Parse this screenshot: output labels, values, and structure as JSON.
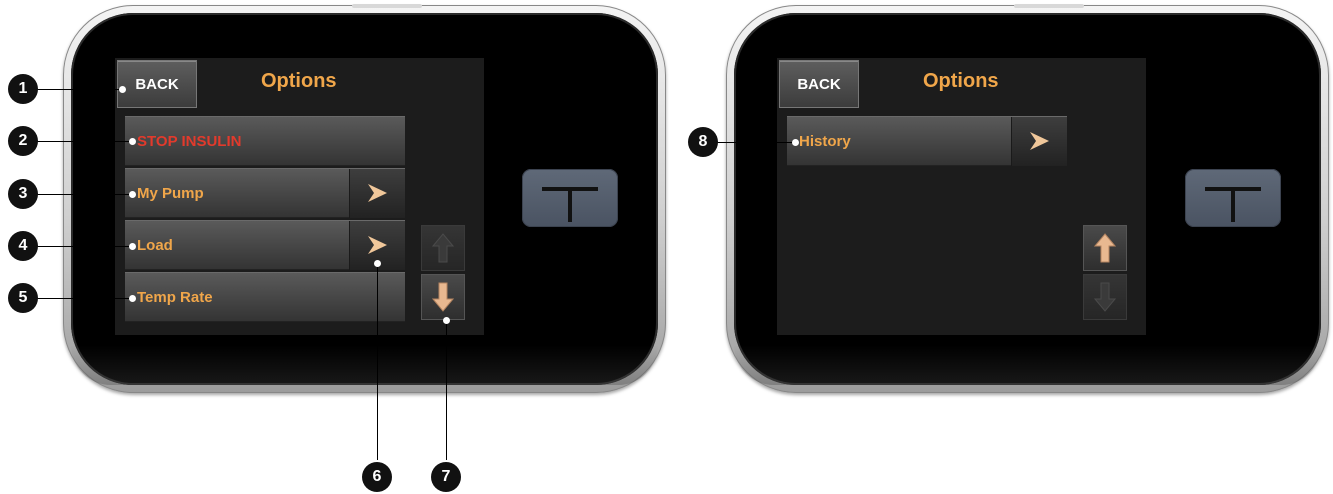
{
  "left_screen": {
    "back_label": "BACK",
    "title": "Options",
    "menu": [
      {
        "label": "STOP INSULIN",
        "has_arrow": false,
        "color": "#e23a2c"
      },
      {
        "label": "My Pump",
        "has_arrow": true
      },
      {
        "label": "Load",
        "has_arrow": true
      },
      {
        "label": "Temp Rate",
        "has_arrow": false
      }
    ],
    "scroll": {
      "up_enabled": false,
      "down_enabled": true
    }
  },
  "right_screen": {
    "back_label": "BACK",
    "title": "Options",
    "menu": [
      {
        "label": "History",
        "has_arrow": true
      }
    ],
    "scroll": {
      "up_enabled": true,
      "down_enabled": false
    }
  },
  "callouts": [
    "1",
    "2",
    "3",
    "4",
    "5",
    "6",
    "7",
    "8"
  ],
  "colors": {
    "accent": "#f0a64a",
    "stop": "#e23a2c",
    "screen": "#1c1c1c",
    "home_button": "#555f6e"
  },
  "icons": {
    "menu_arrow": "chevron-right-icon",
    "home": "t-logo-icon",
    "scroll_up": "arrow-up-icon",
    "scroll_down": "arrow-down-icon"
  }
}
